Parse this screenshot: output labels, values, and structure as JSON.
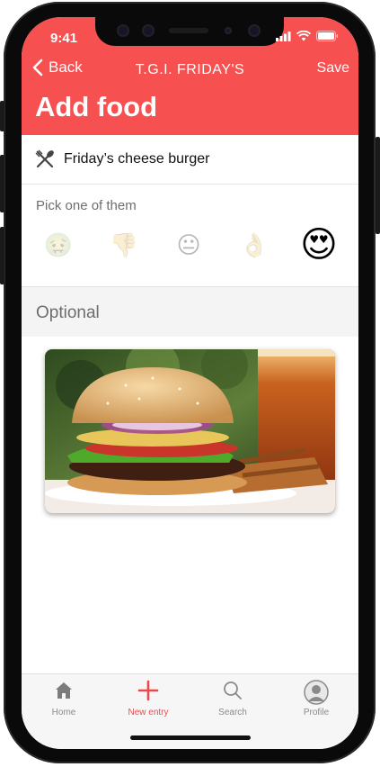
{
  "status": {
    "time": "9:41"
  },
  "nav": {
    "back_label": "Back",
    "title": "T.G.I. FRIDAY'S",
    "save_label": "Save"
  },
  "page": {
    "title": "Add food"
  },
  "food": {
    "name": "Friday’s cheese burger"
  },
  "rating": {
    "label": "Pick one of them",
    "options": [
      {
        "icon": "sick-face-icon",
        "glyph": "🤢"
      },
      {
        "icon": "thumbs-down-icon",
        "glyph": "👎"
      },
      {
        "icon": "neutral-face-icon",
        "glyph": "😐"
      },
      {
        "icon": "ok-hand-icon",
        "glyph": "👌"
      },
      {
        "icon": "heart-eyes-face-icon",
        "glyph": "😍"
      }
    ],
    "selected_index": 4
  },
  "optional": {
    "label": "Optional"
  },
  "tabs": [
    {
      "label": "Home",
      "icon": "home-icon"
    },
    {
      "label": "New entry",
      "icon": "plus-icon"
    },
    {
      "label": "Search",
      "icon": "search-icon"
    },
    {
      "label": "Profile",
      "icon": "profile-icon"
    }
  ],
  "colors": {
    "accent": "#f65050",
    "active_tab": "#e84b4b"
  }
}
